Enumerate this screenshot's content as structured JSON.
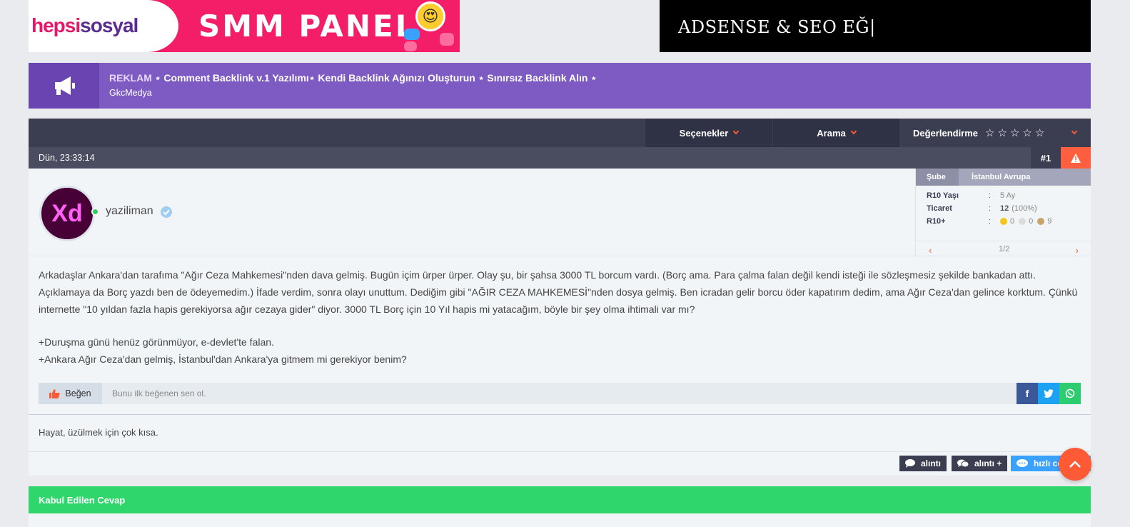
{
  "banners": {
    "left": {
      "logo_part1": "hepsi",
      "logo_part2": "sosyal",
      "title": "SMM PANEL"
    },
    "right": {
      "text": "ADSENSE & SEO EĞ|"
    }
  },
  "announcement": {
    "tag": "REKLAM",
    "text": "⋆ Comment Backlink v.1 Yazılımı⋆ Kendi Backlink Ağınızı Oluşturun ⋆ Sınırsız Backlink Alın ⋆",
    "author": "GkcMedya",
    "icon": "megaphone-icon"
  },
  "toolbar": {
    "options_label": "Seçenekler",
    "search_label": "Arama",
    "rating_label": "Değerlendirme",
    "stars": [
      "☆",
      "☆",
      "☆",
      "☆",
      "☆"
    ]
  },
  "post": {
    "date": "Dün, 23:33:14",
    "number": "#1",
    "author": {
      "avatar_text": "Xd",
      "username": "yaziliman"
    },
    "info": {
      "header_key": "Şube",
      "header_value": "İstanbul Avrupa",
      "rows": [
        {
          "key": "R10 Yaşı",
          "sep": ":",
          "value": "5 Ay"
        },
        {
          "key": "Ticaret",
          "sep": ":",
          "value_bold": "12",
          "value": "(100%)"
        },
        {
          "key": "R10+",
          "sep": ":",
          "gold": "0",
          "silver": "0",
          "bronze": "9"
        }
      ],
      "pager": "1/2",
      "prev": "‹",
      "next": "›"
    },
    "content": {
      "p1": "Arkadaşlar Ankara'dan tarafıma \"Ağır Ceza Mahkemesi\"nden dava gelmiş. Bugün içim ürper ürper. Olay şu, bir şahsa 3000 TL borcum vardı. (Borç ama. Para çalma falan değil kendi isteği ile sözleşmesiz şekilde bankadan attı. Açıklamaya da Borç yazdı ben de ödeyemedim.) İfade verdim, sonra olayı unuttum. Dediğim gibi \"AĞIR CEZA MAHKEMESİ\"nden dosya gelmiş. Ben icradan gelir borcu öder kapatırım dedim, ama Ağır Ceza'dan gelince korktum. Çünkü internette \"10 yıldan fazla hapis gerekiyorsa ağır cezaya gider\" diyor. 3000 TL Borç için 10 Yıl hapis mi yatacağım, böyle bir şey olma ihtimali var mı?",
      "p2": "+Duruşma günü henüz görünmüyor, e-devlet'te falan.",
      "p3": "+Ankara Ağır Ceza'dan gelmiş, İstanbul'dan Ankara'ya gitmem mi gerekiyor benim?"
    },
    "like_label": "Beğen",
    "like_hint": "Bunu ilk beğenen sen ol.",
    "signature": "Hayat, üzülmek için çok kısa.",
    "quote_label": "alıntı",
    "multiquote_label": "alıntı +",
    "quick_reply_label": "hızlı cevap"
  },
  "accepted_answer_label": "Kabul Edilen Cevap",
  "colors": {
    "accent": "#ff5a36",
    "announcement": "#7e5bc2",
    "toolbar": "#3b3d51",
    "accepted": "#2ed66b"
  }
}
